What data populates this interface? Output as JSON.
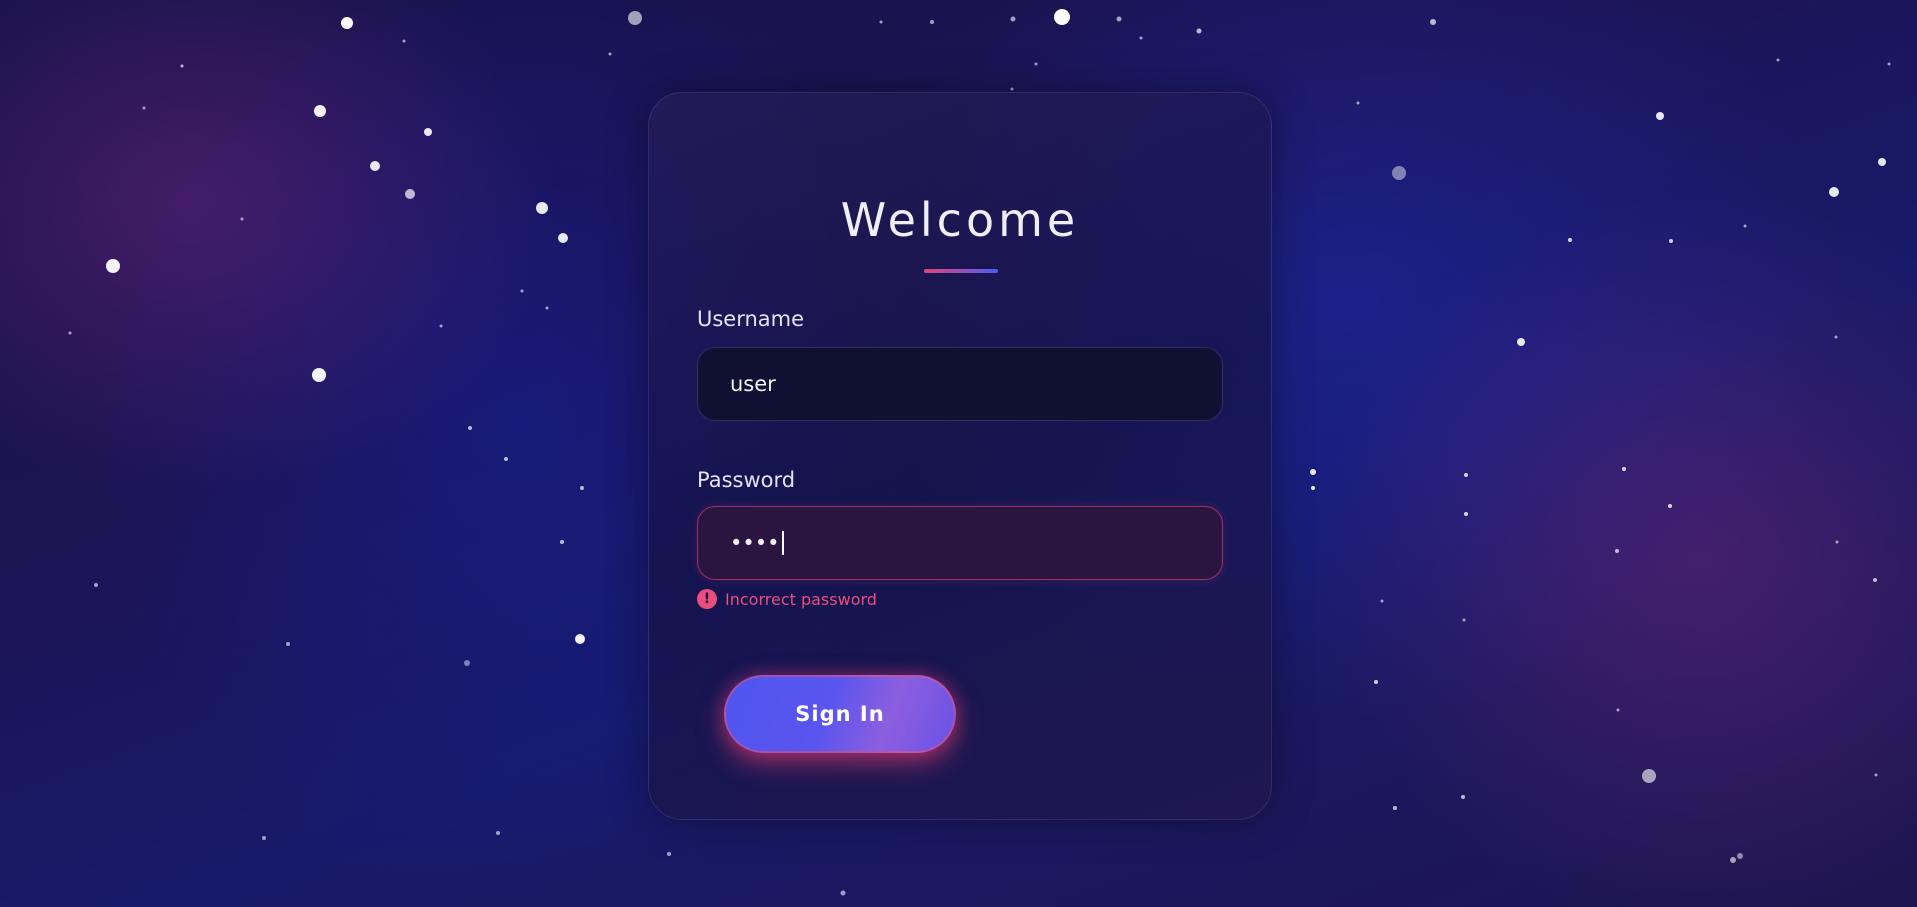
{
  "login": {
    "title": "Welcome",
    "username_label": "Username",
    "username_value": "user",
    "password_label": "Password",
    "password_value": "••••",
    "error_icon": "!",
    "error_text": "Incorrect password",
    "signin_label": "Sign In"
  },
  "colors": {
    "accent_pink": "#ea4d7c",
    "accent_blue": "#4e55f0",
    "text_light": "#f1eefc"
  },
  "icons": {
    "error": "error-alert-icon"
  }
}
